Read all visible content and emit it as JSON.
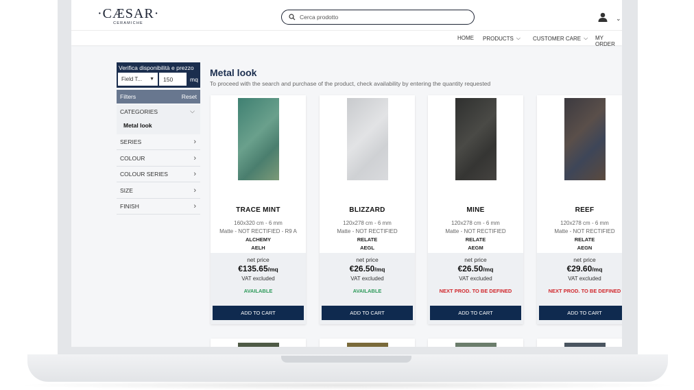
{
  "brand": {
    "logo_main": "·CÆSAR·",
    "logo_sub": "CERAMICHE"
  },
  "search": {
    "placeholder": "Cerca prodotto"
  },
  "nav": {
    "items": [
      "HOME",
      "PRODUCTS",
      "CUSTOMER CARE",
      "MY ORDER"
    ]
  },
  "availability": {
    "title": "Verifica disponibilità e prezzo",
    "select_value": "Field T...",
    "qty": "150",
    "unit": "mq"
  },
  "filters": {
    "label": "Filters",
    "reset": "Reset"
  },
  "categories": {
    "label": "CATEGORIES",
    "selected": "Metal look"
  },
  "filter_list": [
    "SERIES",
    "COLOUR",
    "COLOUR SERIES",
    "SIZE",
    "FINISH"
  ],
  "page": {
    "title": "Metal look",
    "subtitle": "To proceed with the search and purchase of the product, check availability by entering the quantity requested"
  },
  "product_labels": {
    "net_price": "net price",
    "vat": "VAT excluded",
    "add_to_cart": "ADD TO CART",
    "unit": "/mq"
  },
  "products": [
    {
      "name": "TRACE MINT",
      "size": "160x320 cm - 6 mm",
      "finish": "Matte - NOT RECTIFIED - R9 A",
      "series": "ALCHEMY",
      "code": "AELH",
      "price": "€135.65",
      "status": "AVAILABLE",
      "status_color": "#2e9a5a",
      "tile_color": "#4f8f7a"
    },
    {
      "name": "BLIZZARD",
      "size": "120x278 cm - 6 mm",
      "finish": "Matte - NOT RECTIFIED",
      "series": "RELATE",
      "code": "AEGL",
      "price": "€26.50",
      "status": "AVAILABLE",
      "status_color": "#2e9a5a",
      "tile_color": "#d4d6d9"
    },
    {
      "name": "MINE",
      "size": "120x278 cm - 6 mm",
      "finish": "Matte - NOT RECTIFIED",
      "series": "RELATE",
      "code": "AEGM",
      "price": "€26.50",
      "status": "NEXT PROD. TO BE DEFINED",
      "status_color": "#d0262b",
      "tile_color": "#3a3a38"
    },
    {
      "name": "REEF",
      "size": "120x278 cm - 6 mm",
      "finish": "Matte - NOT RECTIFIED",
      "series": "RELATE",
      "code": "AEGN",
      "price": "€29.60",
      "status": "NEXT PROD. TO BE DEFINED",
      "status_color": "#d0262b",
      "tile_color": "#4c4a4e"
    }
  ],
  "colors": {
    "navy": "#1b2e4e",
    "button": "#0f2a4f",
    "filters_bar": "#68778f"
  }
}
